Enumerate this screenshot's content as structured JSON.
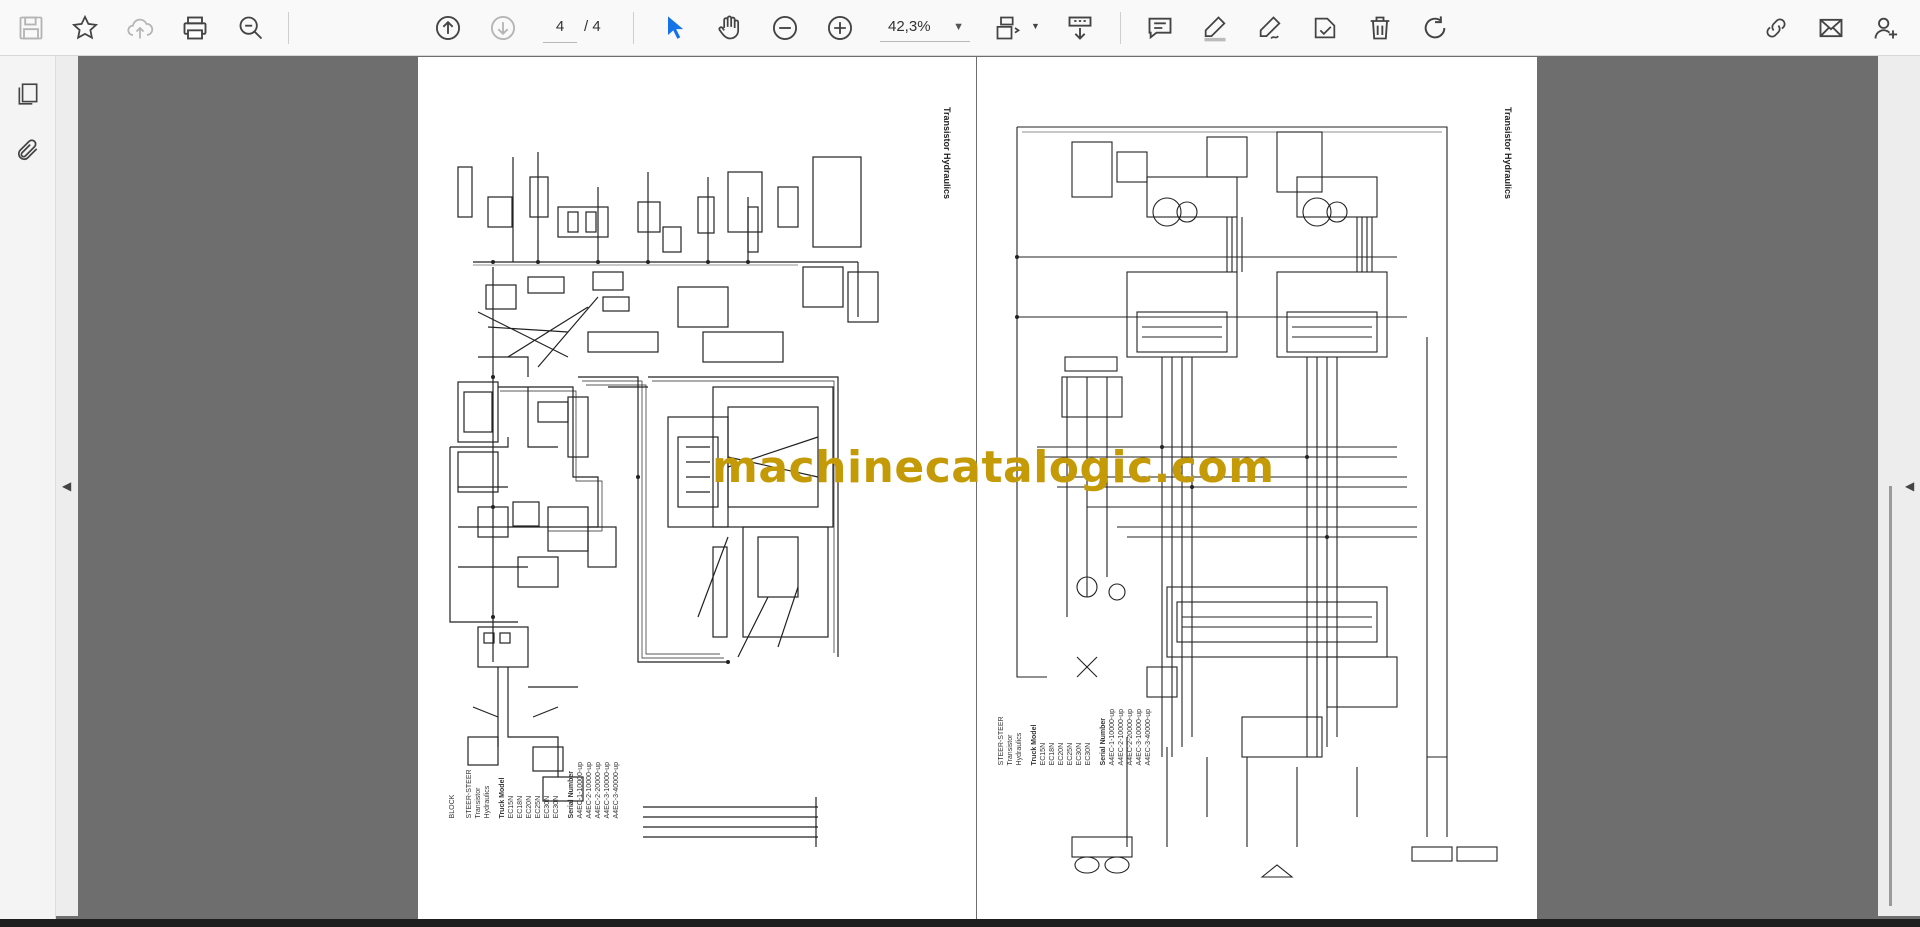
{
  "toolbar": {
    "current_page": "4",
    "page_total": "/ 4",
    "zoom": "42,3%"
  },
  "document": {
    "left_title": "Transistor Hydraulics",
    "right_title": "Transistor Hydraulics",
    "left_legend": {
      "col1": [
        "STEER-STEER",
        "Transistor",
        "Hydraulics"
      ],
      "col2": [
        "Truck Model",
        "EC15N",
        "EC18N",
        "EC20N",
        "EC25N",
        "EC30N",
        "EC30N"
      ],
      "col3": [
        "Serial Number",
        "A4EC-1-10000-up",
        "A4EC-2-10000-up",
        "A4EC-2-20000-up",
        "A4EC-3-10000-up",
        "A4EC-3-40000-up"
      ],
      "block": "BLOCK"
    },
    "right_legend": {
      "col1": [
        "STEER-STEER",
        "Transistor",
        "Hydraulics"
      ],
      "col2": [
        "Truck Model",
        "EC15N",
        "EC18N",
        "EC20N",
        "EC25N",
        "EC30N",
        "EC30N"
      ],
      "col3": [
        "Serial Number",
        "A4EC-1-10000-up",
        "A4EC-2-10000-up",
        "A4EC-2-20000-up",
        "A4EC-3-10000-up",
        "A4EC-3-40000-up"
      ]
    }
  },
  "watermark": "machinecatalogic.com",
  "icons": {
    "toolbar": [
      "save-icon",
      "bookmark-star-icon",
      "upload-cloud-icon",
      "print-icon",
      "zoom-search-icon",
      "page-up-icon",
      "page-down-icon",
      "select-cursor-icon",
      "hand-icon",
      "zoom-out-icon",
      "zoom-in-icon",
      "fit-page-icon",
      "scroll-mode-icon",
      "comment-icon",
      "highlight-pen-icon",
      "draw-icon",
      "stamp-icon",
      "delete-icon",
      "rotate-icon",
      "share-link-icon",
      "email-icon",
      "add-user-icon"
    ],
    "sidebar": [
      "pages-icon",
      "attachment-icon"
    ]
  },
  "colors": {
    "accent": "#1473e6",
    "watermark": "#c49a06",
    "canvas": "#6e6e6e"
  }
}
